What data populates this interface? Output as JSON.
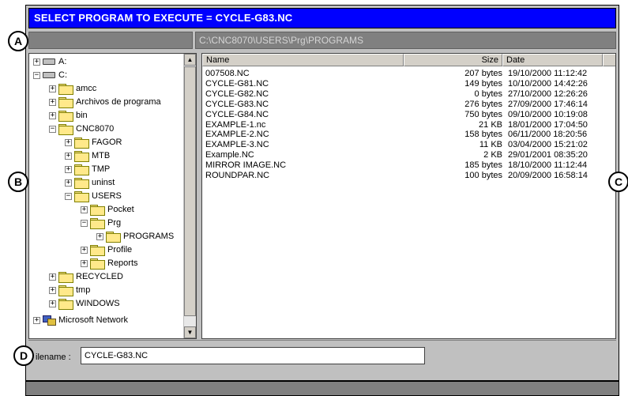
{
  "title": "SELECT PROGRAM TO EXECUTE = CYCLE-G83.NC",
  "path": "C:\\CNC8070\\USERS\\Prg\\PROGRAMS",
  "callouts": {
    "a": "A",
    "b": "B",
    "c": "C",
    "d": "D"
  },
  "tree": [
    {
      "label": "A:",
      "exp": "+",
      "icon": "drive"
    },
    {
      "label": "C:",
      "exp": "−",
      "icon": "drive"
    },
    {
      "label": "amcc",
      "exp": "+",
      "icon": "folder"
    },
    {
      "label": "Archivos de programa",
      "exp": "+",
      "icon": "folder"
    },
    {
      "label": "bin",
      "exp": "+",
      "icon": "folder"
    },
    {
      "label": "CNC8070",
      "exp": "−",
      "icon": "folder"
    },
    {
      "label": "FAGOR",
      "exp": "+",
      "icon": "folder"
    },
    {
      "label": "MTB",
      "exp": "+",
      "icon": "folder"
    },
    {
      "label": "TMP",
      "exp": "+",
      "icon": "folder"
    },
    {
      "label": "uninst",
      "exp": "+",
      "icon": "folder"
    },
    {
      "label": "USERS",
      "exp": "−",
      "icon": "folder"
    },
    {
      "label": "Pocket",
      "exp": "+",
      "icon": "folder"
    },
    {
      "label": "Prg",
      "exp": "−",
      "icon": "folder"
    },
    {
      "label": "PROGRAMS",
      "exp": "+",
      "icon": "folder-open"
    },
    {
      "label": "Profile",
      "exp": "+",
      "icon": "folder"
    },
    {
      "label": "Reports",
      "exp": "+",
      "icon": "folder"
    },
    {
      "label": "RECYCLED",
      "exp": "+",
      "icon": "folder"
    },
    {
      "label": "tmp",
      "exp": "+",
      "icon": "folder"
    },
    {
      "label": "WINDOWS",
      "exp": "+",
      "icon": "folder"
    },
    {
      "label": "Microsoft Network",
      "exp": "+",
      "icon": "network"
    }
  ],
  "columns": {
    "name": "Name",
    "size": "Size",
    "date": "Date"
  },
  "files": [
    {
      "name": "007508.NC",
      "size": "207 bytes",
      "date": "19/10/2000  11:12:42"
    },
    {
      "name": "CYCLE-G81.NC",
      "size": "149 bytes",
      "date": "10/10/2000  14:42:26"
    },
    {
      "name": "CYCLE-G82.NC",
      "size": "0 bytes",
      "date": "27/10/2000  12:26:26"
    },
    {
      "name": "CYCLE-G83.NC",
      "size": "276 bytes",
      "date": "27/09/2000  17:46:14"
    },
    {
      "name": "CYCLE-G84.NC",
      "size": "750 bytes",
      "date": "09/10/2000  10:19:08"
    },
    {
      "name": "EXAMPLE-1.nc",
      "size": "21 KB",
      "date": "18/01/2000  17:04:50"
    },
    {
      "name": "EXAMPLE-2.NC",
      "size": "158 bytes",
      "date": "06/11/2000  18:20:56"
    },
    {
      "name": "EXAMPLE-3.NC",
      "size": "11 KB",
      "date": "03/04/2000  15:21:02"
    },
    {
      "name": "Example.NC",
      "size": "2 KB",
      "date": "29/01/2001  08:35:20"
    },
    {
      "name": "MIRROR IMAGE.NC",
      "size": "185 bytes",
      "date": "18/10/2000  11:12:44"
    },
    {
      "name": "ROUNDPAR.NC",
      "size": "100 bytes",
      "date": "20/09/2000  16:58:14"
    }
  ],
  "filename": {
    "label": "ilename :",
    "value": "CYCLE-G83.NC"
  },
  "colors": {
    "title_bg": "#0000ff",
    "path_bg": "#808080",
    "frame": "#c0c0c0"
  }
}
